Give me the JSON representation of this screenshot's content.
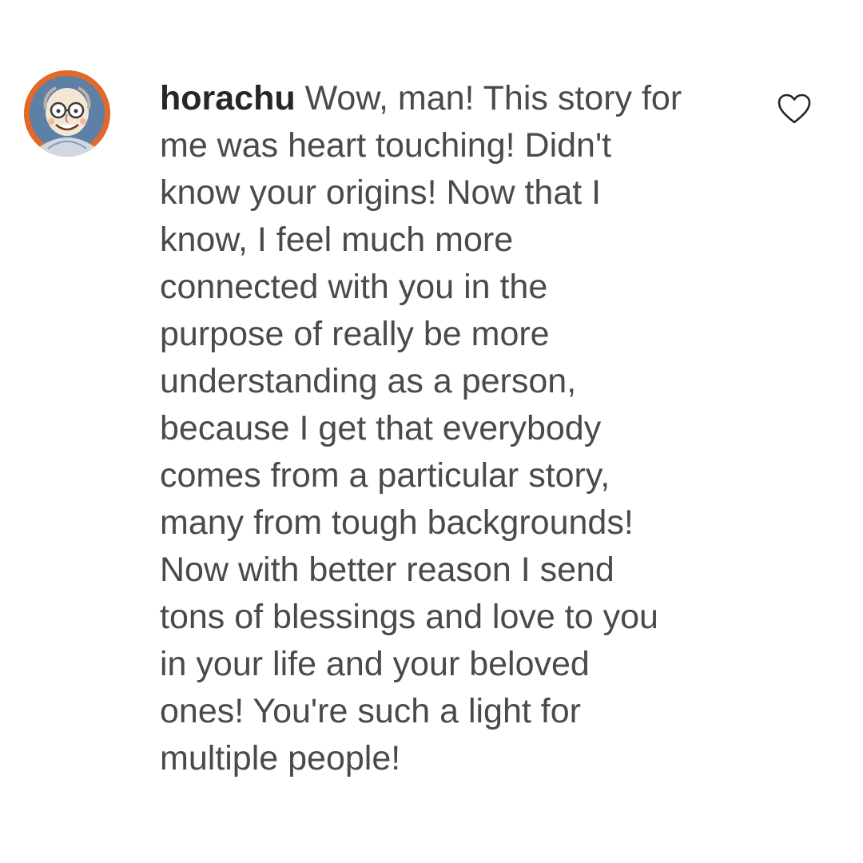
{
  "comment": {
    "username": "horachu",
    "first_line": "Wow, man! This story for",
    "lines": [
      "me was heart touching! Didn't",
      "know your origins! Now that I",
      "know, I feel much more",
      "connected with you in the",
      "purpose of really be more",
      "understanding as a person,",
      "because I get that everybody",
      "comes from a particular story,",
      "many from tough backgrounds!",
      "Now with better reason I send",
      "tons of blessings and love to you",
      "in your life and your beloved",
      "ones! You're such a light for",
      "multiple people!"
    ],
    "avatar_icon": "avatar-illustration-icon",
    "like_icon": "heart-outline-icon"
  },
  "colors": {
    "background": "#ffffff",
    "username": "#262626",
    "text": "#4a4a4a",
    "avatar_ring": "#e2692a",
    "like_stroke": "#262626"
  }
}
